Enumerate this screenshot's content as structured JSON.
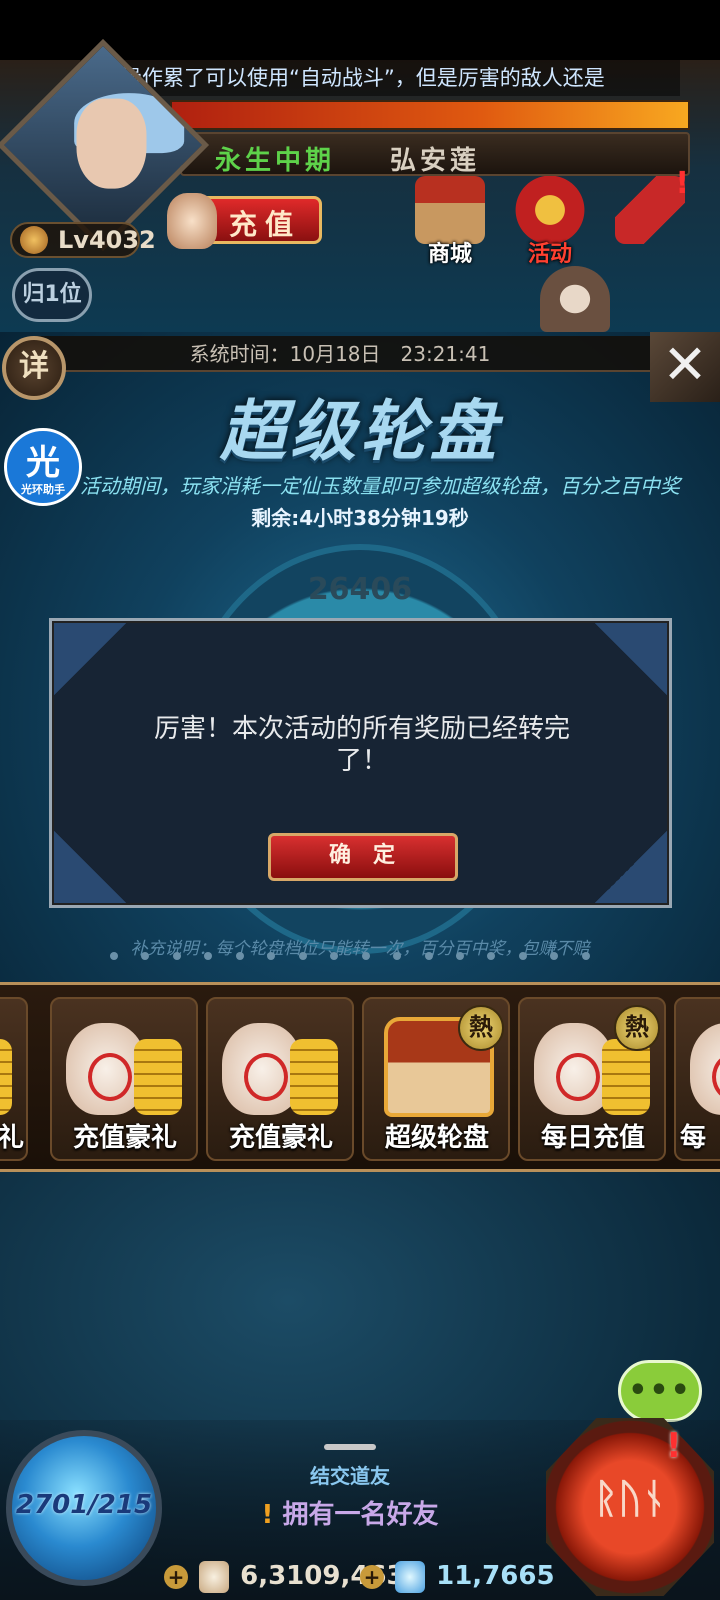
{
  "hud": {
    "scroll_message": "手操作累了可以使用“自动战斗”，但是厉害的敌人还是",
    "realm": "永生中期",
    "player_name": "弘安莲",
    "level": "Lv4032",
    "recharge_label": "充值",
    "shop_label": "商城",
    "event_label": "活动",
    "rank_label": "归1位"
  },
  "panel": {
    "detail_label": "详",
    "close_label": "✕",
    "system_time": "系统时间：10月18日　23:21:41",
    "title": "超级轮盘",
    "description": "活动期间，玩家消耗一定仙玉数量即可参加超级轮盘，百分之百中奖",
    "remaining": "剩余:4小时38分钟19秒",
    "wheel_top_value": "26406",
    "note": "补充说明：每个轮盘档位只能转一次，百分百中奖，包赚不赔"
  },
  "modal": {
    "message": "厉害！本次活动的所有奖励已经转完了！",
    "confirm_label": "确定"
  },
  "assistant": {
    "char": "光",
    "label": "光环助手"
  },
  "tabs": [
    {
      "label": "礼",
      "icon": "money-bag-icon",
      "hot": false
    },
    {
      "label": "充值豪礼",
      "icon": "money-bag-icon",
      "hot": false
    },
    {
      "label": "充值豪礼",
      "icon": "money-bag-icon",
      "hot": false
    },
    {
      "label": "超级轮盘",
      "icon": "treasure-chest-icon",
      "hot": true
    },
    {
      "label": "每日充值",
      "icon": "money-bag-icon",
      "hot": true
    },
    {
      "label": "每",
      "icon": "money-bag-icon",
      "hot": false
    }
  ],
  "hot_badge": "熱",
  "bottom": {
    "exp": "2701/215",
    "friend_title": "结交道友",
    "friend_warn": "!",
    "friend_note": "拥有一名好友",
    "gold": "6,3109,4635",
    "jade": "11,7665",
    "chat_label": "•••",
    "battle_rune": "ᚱᚢᚾ",
    "battle_alert": "!"
  }
}
